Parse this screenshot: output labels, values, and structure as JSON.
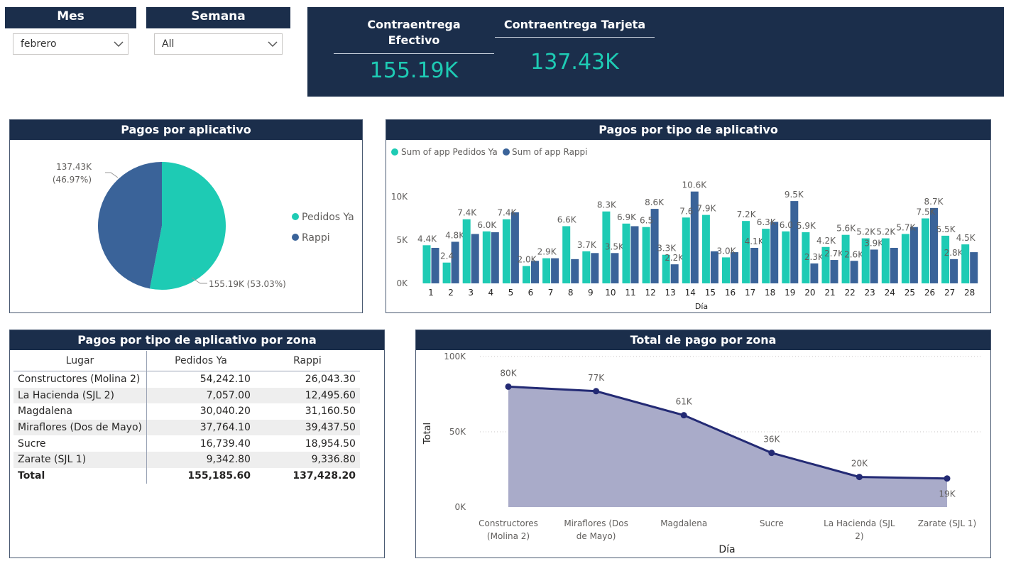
{
  "slicers": {
    "mes": {
      "title": "Mes",
      "value": "febrero"
    },
    "semana": {
      "title": "Semana",
      "value": "All"
    }
  },
  "kpis": {
    "efectivo": {
      "label_line1": "Contraentrega",
      "label_line2": "Efectivo",
      "value": "155.19K"
    },
    "tarjeta": {
      "label": "Contraentrega Tarjeta",
      "value": "137.43K"
    }
  },
  "colors": {
    "navy": "#1b2e4b",
    "teal": "#1ecbb4",
    "blue": "#3a6399",
    "area": "#a9abc9",
    "line": "#232a74"
  },
  "pie": {
    "title": "Pagos por aplicativo",
    "legend": [
      "Pedidos Ya",
      "Rappi"
    ],
    "label_rappi_1": "137.43K",
    "label_rappi_2": "(46.97%)",
    "label_pedidos": "155.19K (53.03%)"
  },
  "bar": {
    "title": "Pagos por tipo de aplicativo",
    "xlabel": "Día",
    "legend": [
      "Sum of app Pedidos Ya",
      "Sum of app Rappi"
    ]
  },
  "table": {
    "title": "Pagos por tipo de aplicativo por zona",
    "headers": [
      "Lugar",
      "Pedidos Ya",
      "Rappi"
    ],
    "rows": [
      [
        "Constructores (Molina 2)",
        "54,242.10",
        "26,043.30"
      ],
      [
        "La Hacienda (SJL 2)",
        "7,057.00",
        "12,495.60"
      ],
      [
        "Magdalena",
        "30,040.20",
        "31,160.50"
      ],
      [
        "Miraflores (Dos de Mayo)",
        "37,764.10",
        "39,437.50"
      ],
      [
        "Sucre",
        "16,739.40",
        "18,954.50"
      ],
      [
        "Zarate (SJL 1)",
        "9,342.80",
        "9,336.80"
      ]
    ],
    "total": [
      "Total",
      "155,185.60",
      "137,428.20"
    ]
  },
  "area": {
    "title": "Total de pago por zona",
    "xlabel": "Día",
    "ylabel": "Total"
  },
  "chart_data": [
    {
      "type": "pie",
      "title": "Pagos por aplicativo",
      "categories": [
        "Pedidos Ya",
        "Rappi"
      ],
      "values": [
        155190,
        137430
      ],
      "percent": [
        53.03,
        46.97
      ],
      "data_labels": [
        "155.19K (53.03%)",
        "137.43K (46.97%)"
      ],
      "legend": "right"
    },
    {
      "type": "bar",
      "title": "Pagos por tipo de aplicativo",
      "xlabel": "Día",
      "ylabel": "",
      "categories": [
        1,
        2,
        3,
        4,
        5,
        6,
        7,
        8,
        9,
        10,
        11,
        12,
        13,
        14,
        15,
        16,
        17,
        18,
        19,
        20,
        21,
        22,
        23,
        24,
        25,
        26,
        27,
        28
      ],
      "series": [
        {
          "name": "Sum of app Pedidos Ya",
          "values": [
            4.4,
            2.4,
            7.4,
            6.0,
            7.4,
            2.0,
            2.9,
            6.6,
            3.7,
            8.3,
            6.9,
            6.5,
            3.3,
            7.6,
            7.9,
            3.0,
            7.2,
            6.3,
            6.0,
            5.9,
            4.2,
            5.6,
            5.2,
            5.2,
            5.7,
            7.5,
            5.5,
            4.5
          ]
        },
        {
          "name": "Sum of app Rappi",
          "values": [
            4.1,
            4.8,
            5.7,
            5.9,
            8.2,
            2.6,
            2.9,
            2.8,
            3.5,
            3.5,
            6.6,
            8.6,
            2.2,
            10.6,
            3.7,
            3.6,
            4.1,
            7.1,
            9.5,
            2.3,
            2.7,
            2.6,
            3.9,
            4.1,
            6.5,
            8.7,
            2.8,
            3.6
          ]
        }
      ],
      "value_units": "K",
      "data_labels": [
        "4.4K",
        "2.4",
        "7.4K",
        "6.0K",
        "7.4K",
        "2.0K",
        "2.9K",
        "6.6K",
        "3.7K",
        "8.3K",
        "6.9K",
        "6.5",
        "3.3K",
        "7.6",
        "7.9K",
        "3.0K",
        "7.2K",
        "6.3K",
        "6.0",
        "5.9K",
        "4.2K",
        "5.6K",
        "5.2K",
        "5.2K",
        "5.7K",
        "7.5K",
        "5.5K",
        "4.5K"
      ],
      "data_labels_rappi": {
        "2": "4.8K",
        "10": "3.5K",
        "12": "8.6K",
        "13": "2.2K",
        "14": "10.6K",
        "17": "4.1K",
        "19": "9.5K",
        "20": "2.3K",
        "21": "2.7K",
        "22": "2.6K",
        "23": "3.9K",
        "26": "8.7K",
        "27": "2.8K"
      },
      "yticks": [
        "0K",
        "5K",
        "10K"
      ],
      "ylim": [
        0,
        12
      ],
      "legend": "top-left"
    },
    {
      "type": "area",
      "title": "Total de pago por zona",
      "xlabel": "Día",
      "ylabel": "Total",
      "categories": [
        [
          "Constructores",
          "(Molina 2)"
        ],
        [
          "Miraflores (Dos",
          "de Mayo)"
        ],
        [
          "Magdalena"
        ],
        [
          "Sucre"
        ],
        [
          "La Hacienda (SJL",
          "2)"
        ],
        [
          "Zarate (SJL 1)"
        ]
      ],
      "values": [
        80,
        77,
        61,
        36,
        20,
        19
      ],
      "data_labels": [
        "80K",
        "77K",
        "61K",
        "36K",
        "20K",
        "19K"
      ],
      "yticks": [
        "0K",
        "50K",
        "100K"
      ],
      "ylim": [
        0,
        100
      ],
      "grid": true
    }
  ]
}
